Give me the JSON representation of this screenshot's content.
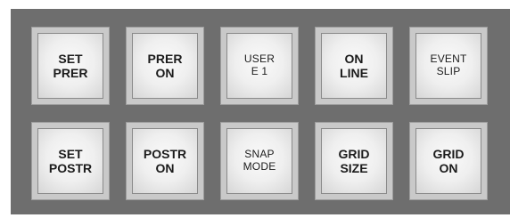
{
  "panel": {
    "rows": [
      [
        {
          "line1": "SET",
          "line2": "PRER"
        },
        {
          "line1": "PRER",
          "line2": "ON"
        },
        {
          "line1": "USER",
          "line2": "E 1"
        },
        {
          "line1": "ON",
          "line2": "LINE"
        },
        {
          "line1": "EVENT",
          "line2": "SLIP"
        }
      ],
      [
        {
          "line1": "SET",
          "line2": "POSTR"
        },
        {
          "line1": "POSTR",
          "line2": "ON"
        },
        {
          "line1": "SNAP",
          "line2": "MODE"
        },
        {
          "line1": "GRID",
          "line2": "SIZE"
        },
        {
          "line1": "GRID",
          "line2": "ON"
        }
      ]
    ]
  }
}
